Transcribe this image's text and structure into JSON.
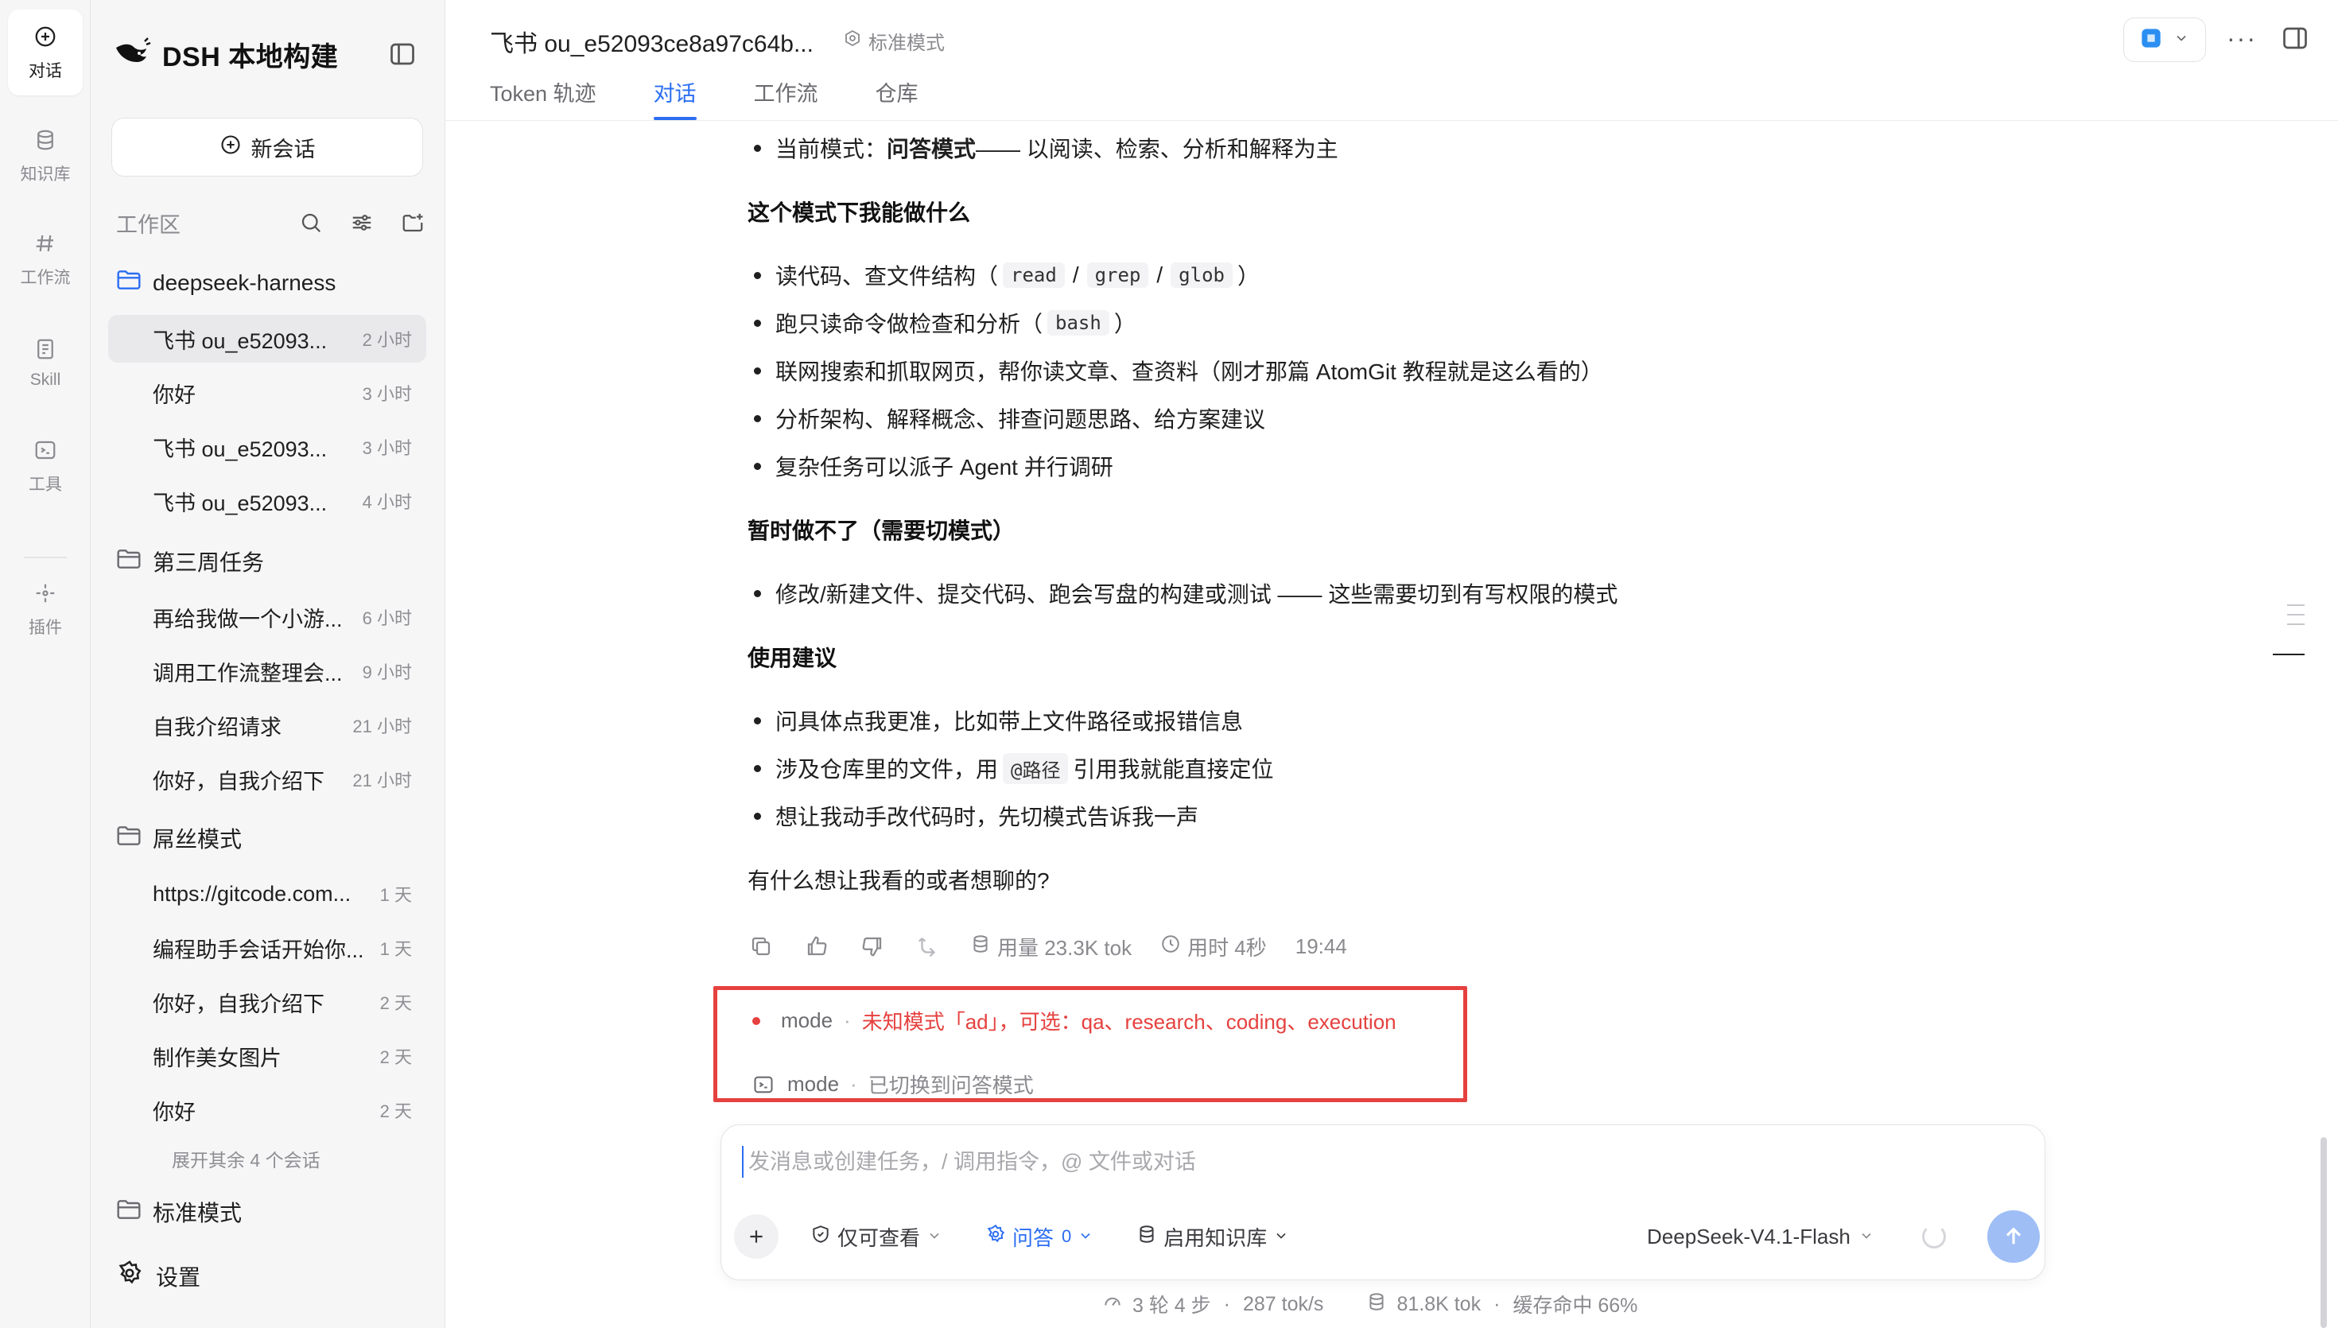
{
  "rail": [
    {
      "label": "对话",
      "icon": "plus-circle-icon",
      "active": true
    },
    {
      "label": "知识库",
      "icon": "database-icon"
    },
    {
      "label": "工作流",
      "icon": "hash-icon"
    },
    {
      "label": "Skill",
      "icon": "skill-icon"
    },
    {
      "label": "工具",
      "icon": "terminal-icon"
    },
    {
      "label": "插件",
      "icon": "plugin-icon"
    }
  ],
  "sidebar": {
    "brand": "DSH 本地构建",
    "new_chat": "新会话",
    "workspace_label": "工作区",
    "folders": [
      {
        "name": "deepseek-harness",
        "conversations": [
          {
            "title": "飞书 ou_e52093...",
            "time": "2 小时",
            "active": true
          },
          {
            "title": "你好",
            "time": "3 小时"
          },
          {
            "title": "飞书 ou_e52093...",
            "time": "3 小时"
          },
          {
            "title": "飞书 ou_e52093...",
            "time": "4 小时"
          }
        ]
      },
      {
        "name": "第三周任务",
        "conversations": [
          {
            "title": "再给我做一个小游...",
            "time": "6 小时"
          },
          {
            "title": "调用工作流整理会...",
            "time": "9 小时"
          },
          {
            "title": "自我介绍请求",
            "time": "21 小时"
          },
          {
            "title": "你好，自我介绍下",
            "time": "21 小时"
          }
        ]
      },
      {
        "name": "屌丝模式",
        "conversations": [
          {
            "title": "https://gitcode.com...",
            "time": "1 天"
          },
          {
            "title": "编程助手会话开始你...",
            "time": "1 天"
          },
          {
            "title": "你好，自我介绍下",
            "time": "2 天"
          },
          {
            "title": "制作美女图片",
            "time": "2 天"
          },
          {
            "title": "你好",
            "time": "2 天"
          }
        ]
      },
      {
        "name": "标准模式",
        "conversations": []
      }
    ],
    "expand_more": "展开其余 4 个会话",
    "settings": "设置"
  },
  "header": {
    "title": "飞书 ou_e52093ce8a97c64b...",
    "mode": "标准模式",
    "tabs": [
      "Token 轨迹",
      "对话",
      "工作流",
      "仓库"
    ],
    "active_tab": 1
  },
  "message": {
    "current_mode_prefix": "当前模式：",
    "current_mode_name": "问答模式",
    "current_mode_suffix": " —— 以阅读、检索、分析和解释为主",
    "h_can": "这个模式下我能做什么",
    "can": {
      "b1_pre": "读代码、查文件结构（",
      "b1_codes": [
        "read",
        "grep",
        "glob"
      ],
      "b1_post": "）",
      "b2_pre": "跑只读命令做检查和分析（",
      "b2_code": "bash",
      "b2_post": "）",
      "b3": "联网搜索和抓取网页，帮你读文章、查资料（刚才那篇 AtomGit 教程就是这么看的）",
      "b4": "分析架构、解释概念、排查问题思路、给方案建议",
      "b5": "复杂任务可以派子 Agent 并行调研"
    },
    "h_cannot": "暂时做不了（需要切模式）",
    "cannot": "修改/新建文件、提交代码、跑会写盘的构建或测试 —— 这些需要切到有写权限的模式",
    "h_tips": "使用建议",
    "tips": {
      "t1": "问具体点我更准，比如带上文件路径或报错信息",
      "t2_pre": "涉及仓库里的文件，用",
      "t2_code": "@路径",
      "t2_post": "引用我就能直接定位",
      "t3": "想让我动手改代码时，先切模式告诉我一声"
    },
    "closing": "有什么想让我看的或者想聊的?"
  },
  "actions": {
    "usage": "用量 23.3K tok",
    "duration": "用时 4秒",
    "time": "19:44"
  },
  "notices": {
    "err_key": "mode",
    "err_msg": "未知模式「ad」，可选：qa、research、coding、execution",
    "ok_key": "mode",
    "ok_msg": "已切换到问答模式"
  },
  "composer": {
    "placeholder": "发消息或创建任务，/ 调用指令，@ 文件或对话",
    "view_only": "仅可查看",
    "qa": "问答",
    "qa_count": "0",
    "kb": "启用知识库",
    "model": "DeepSeek-V4.1-Flash"
  },
  "footer": {
    "steps": "3 轮 4 步",
    "speed": "287 tok/s",
    "tokens": "81.8K tok",
    "cache": "缓存命中 66%"
  },
  "colors": {
    "accent": "#2b6ef2",
    "error": "#e5413f",
    "send_button": "#9fbef6"
  }
}
